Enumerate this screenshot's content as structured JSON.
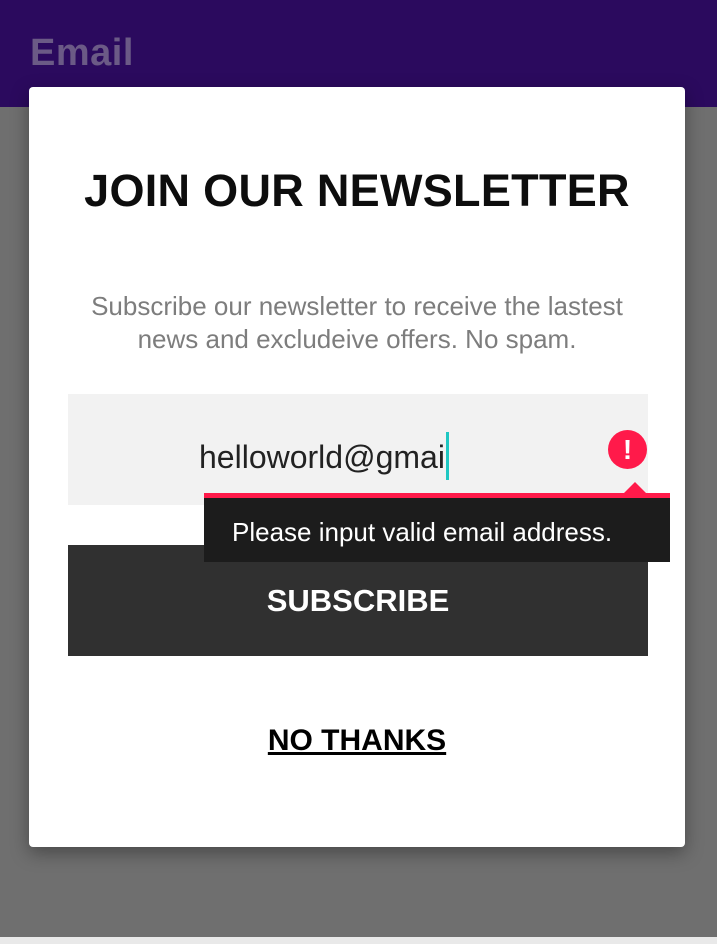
{
  "app_bar": {
    "title": "Email",
    "color": "#2b0a5e"
  },
  "dialog": {
    "headline": "JOIN OUR NEWSLETTER",
    "subtitle": "Subscribe our newsletter to receive the lastest news and excludeive offers. No spam.",
    "email_field": {
      "value": "helloworld@gmai",
      "error_icon": "error-exclamation-icon",
      "error_color": "#ff1a4a"
    },
    "error_tooltip": {
      "message": "Please input valid email address."
    },
    "subscribe_label": "SUBSCRIBE",
    "no_thanks_label": "NO THANKS"
  }
}
